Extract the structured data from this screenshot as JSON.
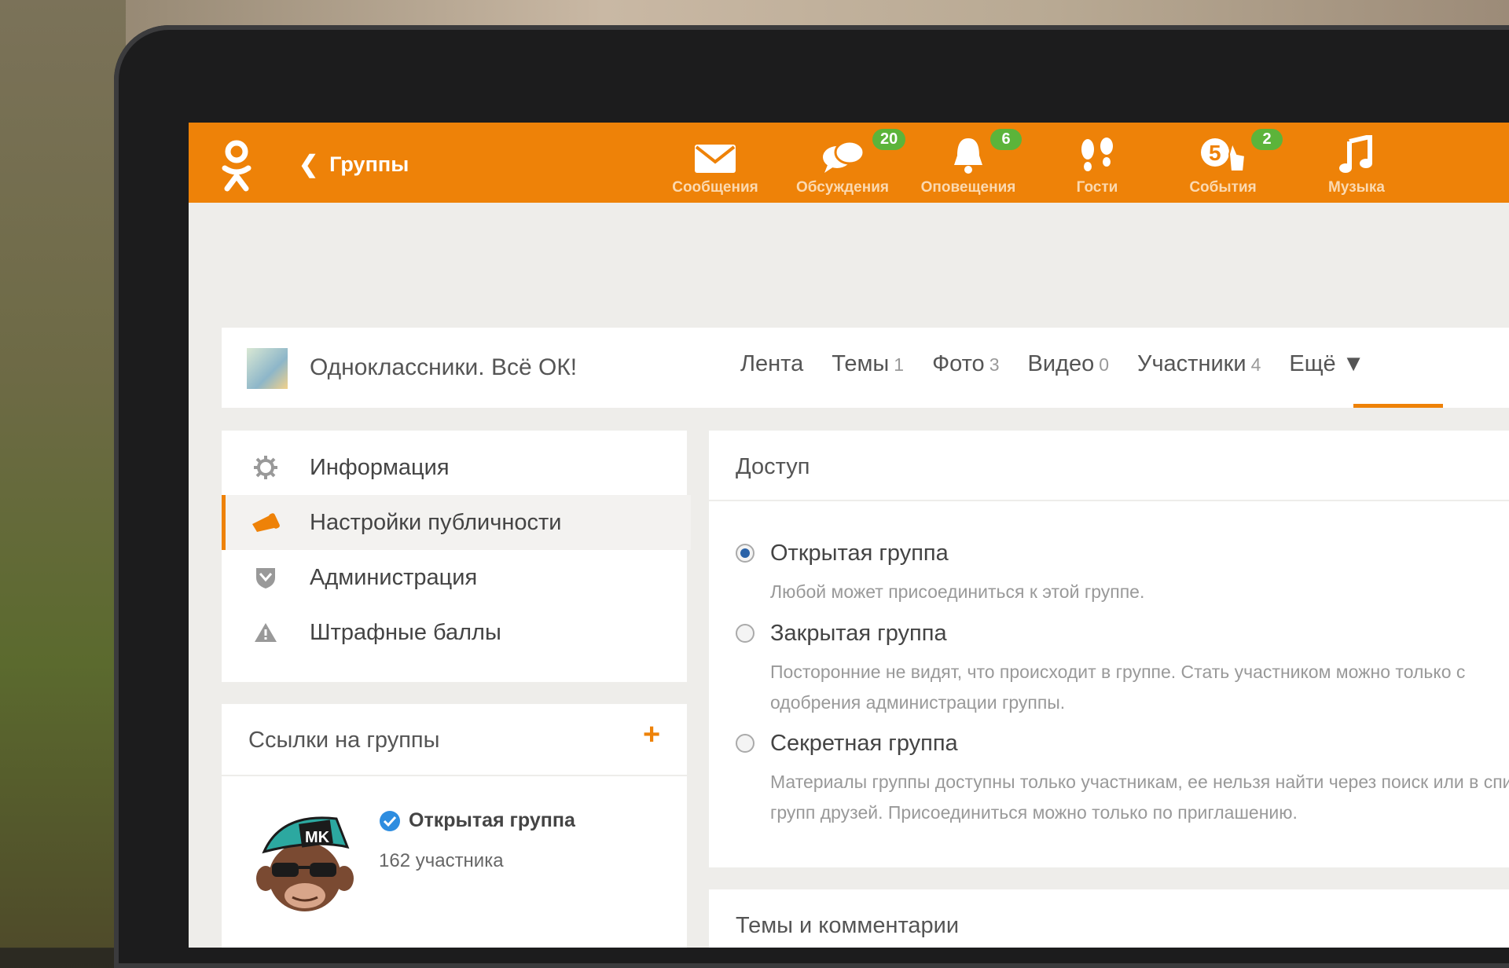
{
  "topbar": {
    "back_label": "Группы",
    "nav": [
      {
        "label": "Сообщения",
        "icon": "envelope-icon",
        "badge": ""
      },
      {
        "label": "Обсуждения",
        "icon": "chat-bubbles-icon",
        "badge": "20"
      },
      {
        "label": "Оповещения",
        "icon": "bell-icon",
        "badge": "6"
      },
      {
        "label": "Гости",
        "icon": "footprints-icon",
        "badge": ""
      },
      {
        "label": "События",
        "icon": "events-icon",
        "badge": "2"
      },
      {
        "label": "Музыка",
        "icon": "music-note-icon",
        "badge": ""
      }
    ]
  },
  "group": {
    "name": "Одноклассники. Всё ОК!",
    "tabs": [
      {
        "label": "Лента",
        "count": ""
      },
      {
        "label": "Темы",
        "count": "1"
      },
      {
        "label": "Фото",
        "count": "3"
      },
      {
        "label": "Видео",
        "count": "0"
      },
      {
        "label": "Участники",
        "count": "4"
      },
      {
        "label": "Ещё ▼",
        "count": ""
      }
    ]
  },
  "menu": [
    {
      "label": "Информация",
      "icon": "gear-icon"
    },
    {
      "label": "Настройки публичности",
      "icon": "megaphone-icon"
    },
    {
      "label": "Администрация",
      "icon": "shield-icon"
    },
    {
      "label": "Штрафные баллы",
      "icon": "warning-icon"
    }
  ],
  "links": {
    "title": "Ссылки на группы",
    "plus": "+",
    "item": {
      "title": "Открытая группа",
      "members": "162 участника"
    }
  },
  "access": {
    "title": "Доступ",
    "options": [
      {
        "title": "Открытая группа",
        "desc": "Любой может присоединиться к этой группе.",
        "selected": true
      },
      {
        "title": "Закрытая группа",
        "desc": "Посторонние не видят, что происходит в группе. Стать участником можно только с одобрения администрации группы.",
        "selected": false
      },
      {
        "title": "Секретная группа",
        "desc": "Материалы группы доступны только участникам, ее нельзя найти через поиск или в списках групп друзей. Присоединиться можно только по приглашению.",
        "selected": false
      }
    ]
  },
  "topics": {
    "title": "Темы и комментарии"
  },
  "colors": {
    "accent": "#ee8208",
    "badge": "#5cb43a",
    "radio": "#2a62a8"
  }
}
